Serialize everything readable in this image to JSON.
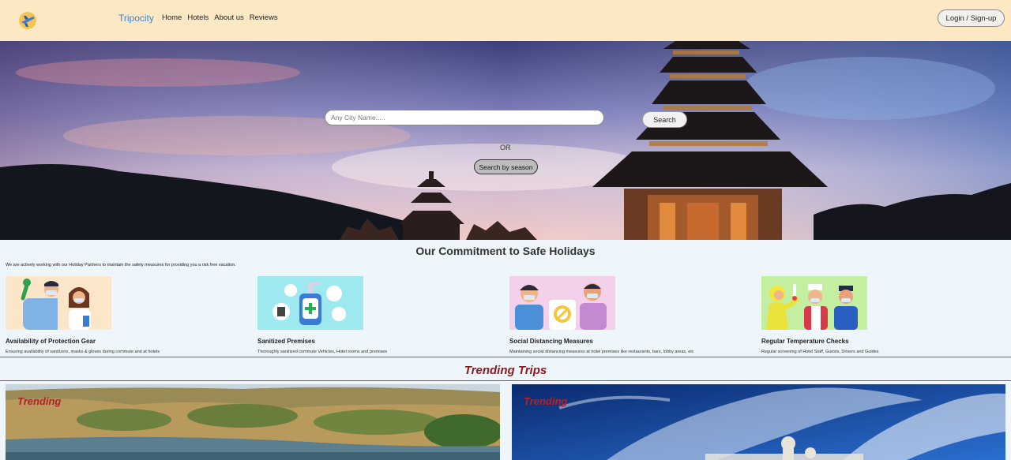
{
  "header": {
    "brand": "Tripocity",
    "nav": [
      "Home",
      "Hotels",
      "About us",
      "Reviews"
    ],
    "login_label": "Login / Sign-up"
  },
  "hero": {
    "search_placeholder": "Any City Name.....",
    "search_label": "Search",
    "or_text": "OR",
    "season_label": "Search by season"
  },
  "commitment": {
    "title": "Our Commitment to Safe Holidays",
    "description": "We are actively working with our Holiday Partners to maintain the safety measures for providing you a risk free vacation.",
    "cards": [
      {
        "title": "Availability of Protection Gear",
        "desc": "Ensuring availability of sanitizers, masks & gloves during commute and at hotels"
      },
      {
        "title": "Sanitized Premises",
        "desc": "Thoroughly sanitized commute Vehicles, Hotel rooms and premises"
      },
      {
        "title": "Social Distancing Measures",
        "desc": "Maintaining social distancing measures at hotel premises like restaurants, bars, lobby areas, etc"
      },
      {
        "title": "Regular Temperature Checks",
        "desc": "Regular screening of Hotel Staff, Guests, Drivers and Guides"
      }
    ]
  },
  "trending": {
    "title": "Trending Trips",
    "badge": "Trending"
  },
  "colors": {
    "header_bg": "#fde8c4",
    "brand": "#3b82d6",
    "trending_title": "#8b1a1a"
  }
}
